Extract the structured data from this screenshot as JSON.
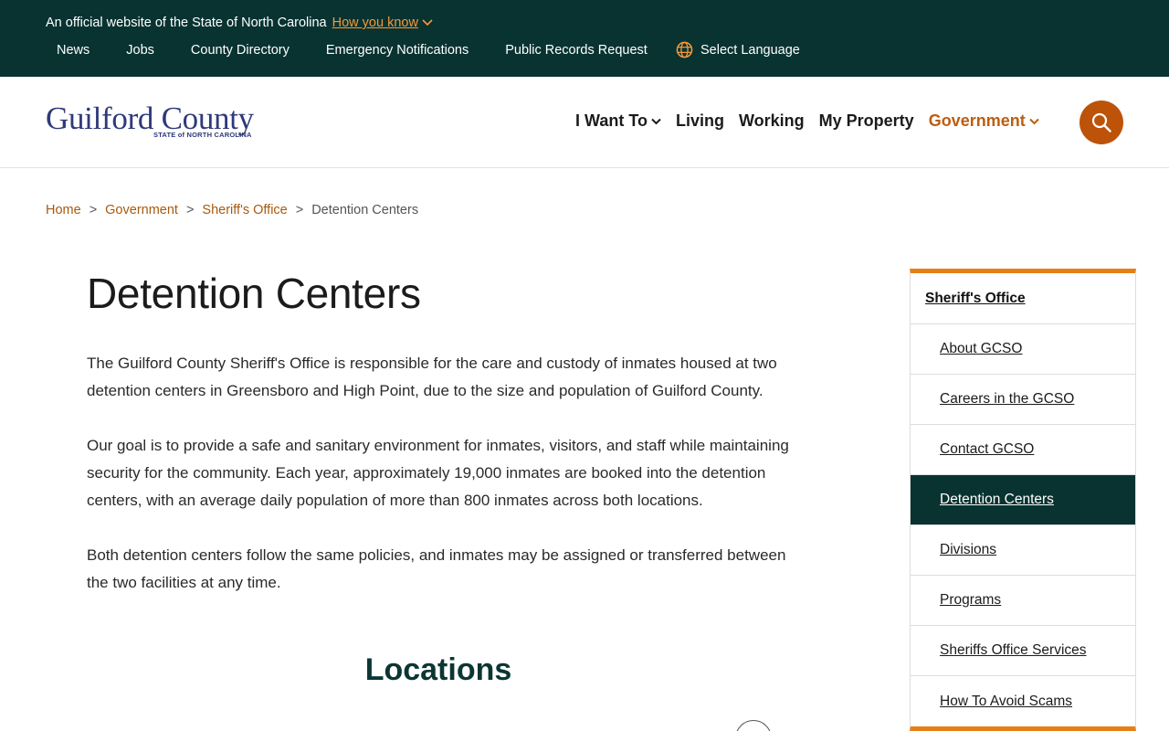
{
  "topbar": {
    "official_text": "An official website of the State of North Carolina",
    "how_you_know": "How you know",
    "links": [
      "News",
      "Jobs",
      "County Directory",
      "Emergency Notifications",
      "Public Records Request"
    ],
    "language": "Select Language"
  },
  "header": {
    "logo_title": "Guilford County",
    "logo_sub": "STATE of NORTH CAROLINA",
    "nav": {
      "i_want_to": "I Want To",
      "living": "Living",
      "working": "Working",
      "my_property": "My Property",
      "government": "Government"
    }
  },
  "breadcrumb": {
    "home": "Home",
    "government": "Government",
    "sheriffs_office": "Sheriff's Office",
    "current": "Detention Centers",
    "separator": ">"
  },
  "main": {
    "title": "Detention Centers",
    "paragraphs": [
      "The Guilford County Sheriff's Office is responsible for the care and custody of inmates housed at two detention centers in Greensboro and High Point, due to the size and population of Guilford County.",
      "Our goal is to provide a safe and sanitary environment for inmates, visitors, and staff while maintaining security for the community. Each year, approximately 19,000 inmates are booked into the detention centers, with an average daily population of more than 800 inmates across both locations.",
      "Both detention centers follow the same policies, and inmates may be assigned or transferred between the two facilities at any time."
    ],
    "section_title": "Locations"
  },
  "sidebar": {
    "heading": "Sheriff's Office",
    "items": [
      "About GCSO",
      "Careers in the GCSO",
      "Contact GCSO",
      "Detention Centers",
      "Divisions",
      "Programs",
      "Sheriffs Office Services",
      "How To Avoid Scams"
    ],
    "active_index": 3
  },
  "colors": {
    "dark_teal": "#093331",
    "accent_orange": "#e77f17",
    "link_brown": "#a85a0d",
    "search_button": "#bd5209"
  }
}
